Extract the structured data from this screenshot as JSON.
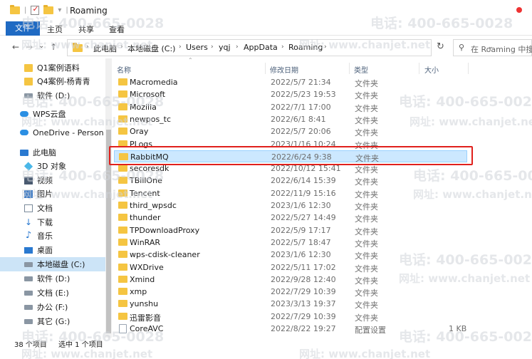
{
  "window": {
    "title": "Roaming"
  },
  "ribbon": {
    "file": "文件",
    "tabs": [
      "主页",
      "共享",
      "查看"
    ]
  },
  "nav": {
    "back": "←",
    "forward": "→",
    "dropdown": "⌄",
    "up": "↑"
  },
  "address": {
    "crumbs": [
      "此电脑",
      "本地磁盘 (C:)",
      "Users",
      "yqj",
      "AppData",
      "Roaming"
    ],
    "dropdown": "⌄",
    "refresh": "↻"
  },
  "search": {
    "placeholder": "在 Roaming 中搜",
    "icon": "search-icon"
  },
  "sidebar": {
    "items": [
      {
        "label": "Q1案例语料",
        "icon": "folder-icon"
      },
      {
        "label": "Q4案例-杨青青",
        "icon": "folder-icon"
      },
      {
        "label": "软件 (D:)",
        "icon": "drive-icon"
      },
      {
        "label": "WPS云盘",
        "icon": "cloud-icon"
      },
      {
        "label": "OneDrive - Person",
        "icon": "cloud-icon"
      },
      {
        "label": "此电脑",
        "icon": "pc-icon"
      },
      {
        "label": "3D 对象",
        "icon": "3d-objects-icon"
      },
      {
        "label": "视频",
        "icon": "video-icon"
      },
      {
        "label": "图片",
        "icon": "pictures-icon"
      },
      {
        "label": "文档",
        "icon": "documents-icon"
      },
      {
        "label": "下载",
        "icon": "download-icon"
      },
      {
        "label": "音乐",
        "icon": "music-icon"
      },
      {
        "label": "桌面",
        "icon": "desktop-icon"
      },
      {
        "label": "本地磁盘 (C:)",
        "icon": "drive-icon"
      },
      {
        "label": "软件 (D:)",
        "icon": "drive-icon"
      },
      {
        "label": "文档 (E:)",
        "icon": "drive-icon"
      },
      {
        "label": "办公 (F:)",
        "icon": "drive-icon"
      },
      {
        "label": "其它 (G:)",
        "icon": "drive-icon"
      }
    ]
  },
  "columns": {
    "name": "名称",
    "modified": "修改日期",
    "type": "类型",
    "size": "大小"
  },
  "files": [
    {
      "name": "Macromedia",
      "date": "2022/5/7 21:34",
      "type": "文件夹",
      "size": ""
    },
    {
      "name": "Microsoft",
      "date": "2022/5/23 19:53",
      "type": "文件夹",
      "size": ""
    },
    {
      "name": "Mozilla",
      "date": "2022/7/1 17:00",
      "type": "文件夹",
      "size": ""
    },
    {
      "name": "newpos_tc",
      "date": "2022/6/1 8:41",
      "type": "文件夹",
      "size": ""
    },
    {
      "name": "Oray",
      "date": "2022/5/7 20:06",
      "type": "文件夹",
      "size": ""
    },
    {
      "name": "PLogs",
      "date": "2023/1/16 10:24",
      "type": "文件夹",
      "size": ""
    },
    {
      "name": "RabbitMQ",
      "date": "2022/6/24 9:38",
      "type": "文件夹",
      "size": ""
    },
    {
      "name": "secoresdk",
      "date": "2022/10/12 15:41",
      "type": "文件夹",
      "size": ""
    },
    {
      "name": "TBillOne",
      "date": "2022/6/14 15:39",
      "type": "文件夹",
      "size": ""
    },
    {
      "name": "Tencent",
      "date": "2022/11/9 15:16",
      "type": "文件夹",
      "size": ""
    },
    {
      "name": "third_wpsdc",
      "date": "2023/1/6 12:30",
      "type": "文件夹",
      "size": ""
    },
    {
      "name": "thunder",
      "date": "2022/5/27 14:49",
      "type": "文件夹",
      "size": ""
    },
    {
      "name": "TPDownloadProxy",
      "date": "2022/5/9 17:17",
      "type": "文件夹",
      "size": ""
    },
    {
      "name": "WinRAR",
      "date": "2022/5/7 18:47",
      "type": "文件夹",
      "size": ""
    },
    {
      "name": "wps-cdisk-cleaner",
      "date": "2023/1/6 12:30",
      "type": "文件夹",
      "size": ""
    },
    {
      "name": "WXDrive",
      "date": "2022/5/11 17:02",
      "type": "文件夹",
      "size": ""
    },
    {
      "name": "Xmind",
      "date": "2022/9/28 12:40",
      "type": "文件夹",
      "size": ""
    },
    {
      "name": "xmp",
      "date": "2022/7/29 10:39",
      "type": "文件夹",
      "size": ""
    },
    {
      "name": "yunshu",
      "date": "2023/3/13 19:37",
      "type": "文件夹",
      "size": ""
    },
    {
      "name": "迅雷影音",
      "date": "2022/7/29 10:39",
      "type": "文件夹",
      "size": ""
    },
    {
      "name": "CoreAVC",
      "date": "2022/8/22 19:27",
      "type": "配置设置",
      "size": "1 KB"
    }
  ],
  "status": {
    "count": "38 个项目",
    "selected": "选中 1 个项目"
  },
  "watermark": {
    "phone": "电话: 400-665-0028",
    "site": "网址: www.chanjet.net"
  },
  "colors": {
    "accent": "#1f6ac3",
    "selection": "#cce8ff",
    "highlight_border": "#e0201c"
  }
}
